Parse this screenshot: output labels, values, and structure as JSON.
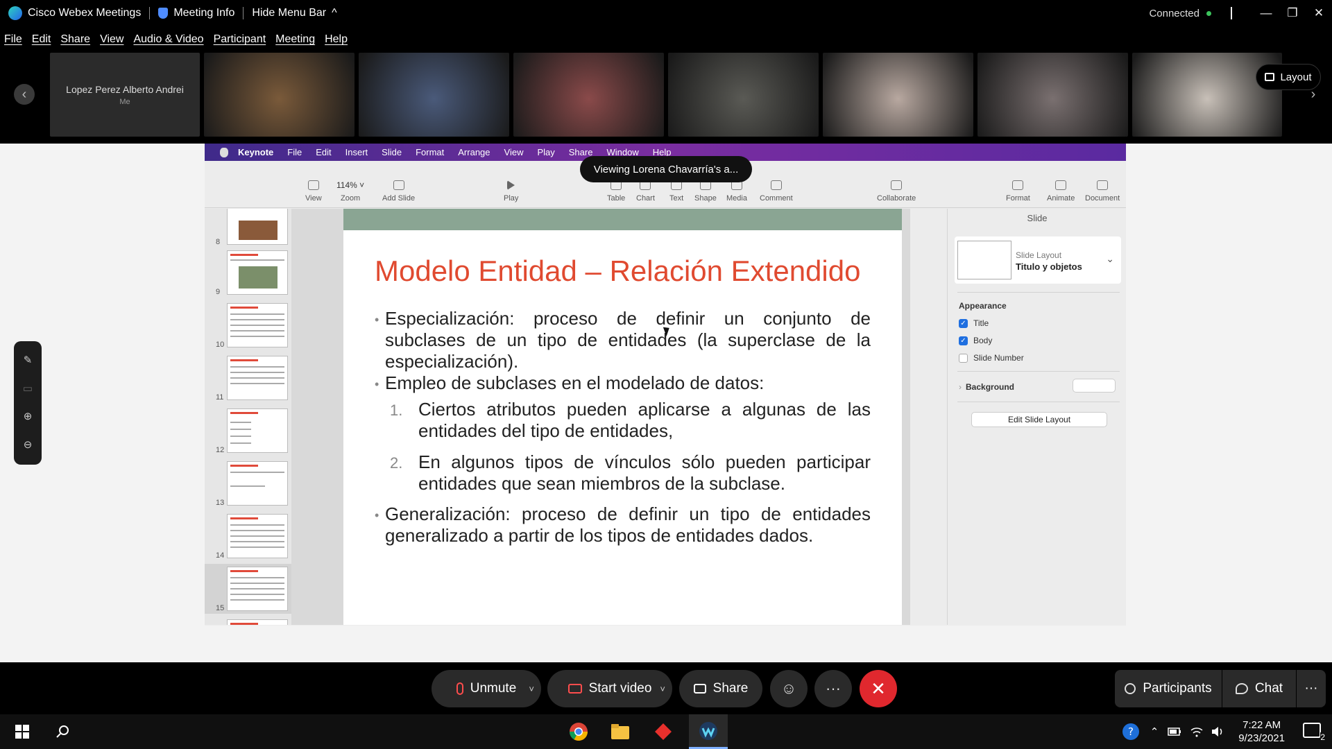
{
  "titlebar": {
    "app_name": "Cisco Webex Meetings",
    "meeting_info": "Meeting Info",
    "hide_menu_bar": "Hide Menu Bar",
    "hide_chevron": "^",
    "status": "Connected",
    "minimize": "—",
    "restore": "❐",
    "close": "✕"
  },
  "menu": [
    "File",
    "Edit",
    "Share",
    "View",
    "Audio & Video",
    "Participant",
    "Meeting",
    "Help"
  ],
  "participants": {
    "prev_arrow": "‹",
    "next_arrow": "›",
    "self_name": "Lopez Perez Alberto Andrei",
    "self_tag": "Me",
    "layout_button": "Layout",
    "video_tiles": [
      {
        "tone": "#7a5a3a"
      },
      {
        "tone": "#4a5a7a"
      },
      {
        "tone": "#8a4a4a"
      },
      {
        "tone": "#5a5a55"
      },
      {
        "tone": "#b8a8a0"
      },
      {
        "tone": "#7a7070"
      },
      {
        "tone": "#c8c0b8"
      }
    ]
  },
  "mac_menubar": [
    "Keynote",
    "File",
    "Edit",
    "Insert",
    "Slide",
    "Format",
    "Arrange",
    "View",
    "Play",
    "Share",
    "Window",
    "Help"
  ],
  "viewing_banner": "Viewing Lorena Chavarría's a...",
  "keynote_toolbar": {
    "view": "View",
    "zoom_value": "114% ˅",
    "zoom": "Zoom",
    "add_slide": "Add Slide",
    "play": "Play",
    "table": "Table",
    "chart": "Chart",
    "text": "Text",
    "shape": "Shape",
    "media": "Media",
    "comment": "Comment",
    "collaborate": "Collaborate",
    "format": "Format",
    "animate": "Animate",
    "document": "Document"
  },
  "navigator": {
    "slides": [
      "8",
      "9",
      "10",
      "11",
      "12",
      "13",
      "14",
      "15"
    ],
    "selected": "15"
  },
  "slide": {
    "title": "Modelo Entidad – Relación Extendido",
    "bullet1": "Especialización: proceso de definir un conjunto de subclases de un tipo de entidades (la superclase de la especialización).",
    "bullet2": "Empleo de subclases en el modelado de datos:",
    "item1_num": "1.",
    "item1": "Ciertos atributos pueden aplicarse a algunas de las entidades del tipo de entidades,",
    "item2_num": "2.",
    "item2": "En algunos tipos de vínculos sólo pueden participar entidades que sean miembros de la subclase.",
    "bullet3": "Generalización: proceso de definir un tipo de entidades generalizado a partir de los tipos de entidades dados.",
    "bullet_glyph": "•"
  },
  "inspector": {
    "tab": "Slide",
    "layout_label": "Slide Layout",
    "layout_value": "Titulo y objetos",
    "appearance": "Appearance",
    "title_cb": "Title",
    "body_cb": "Body",
    "slide_number_cb": "Slide Number",
    "background": "Background",
    "edit_layout": "Edit Slide Layout"
  },
  "controls": {
    "unmute": "Unmute",
    "start_video": "Start video",
    "share": "Share",
    "more": "···",
    "end": "✕",
    "participants": "Participants",
    "chat": "Chat",
    "dropdown": "˅"
  },
  "taskbar": {
    "time": "7:22 AM",
    "date": "9/23/2021",
    "notifications": "2"
  },
  "colors": {
    "slide_title": "#e04a30",
    "end_button": "#e0282e",
    "mac_menubar": "#5a2aa0",
    "connected_dot": "#3cc35c"
  }
}
